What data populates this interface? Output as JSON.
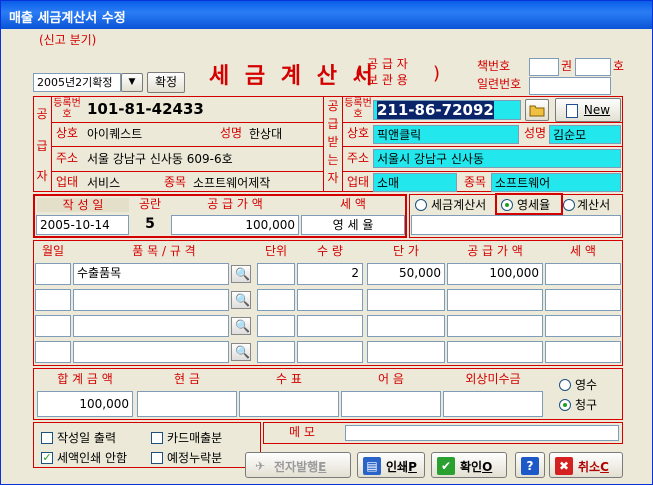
{
  "window": {
    "title": "매출 세금계산서 수정"
  },
  "header": {
    "report_type_label": "(신고 분기)",
    "period_value": "2005년2기확정",
    "confirm_button": "확정",
    "title": "세 금 계 산 서",
    "title_paren": "(",
    "title_paren_close": ")",
    "sub_line1": "공 급 자",
    "sub_line2": "보 관 용",
    "book_label": "책번호",
    "book_unit1": "권",
    "book_unit2": "호",
    "serial_label": "일련번호"
  },
  "supplier": {
    "side_label": [
      "공",
      "급",
      "자"
    ],
    "reg_label": "등록번호",
    "reg_number": "101-81-42433",
    "name_label": "상호",
    "name_value": "아이퀘스트",
    "owner_label": "성명",
    "owner_value": "한상대",
    "addr_label": "주소",
    "addr_value": "서울 강남구 신사동 609-6호",
    "biz_label": "업태",
    "biz_value": "서비스",
    "item_label": "종목",
    "item_value": "소프트웨어제작"
  },
  "buyer": {
    "side_label": [
      "공",
      "급",
      "받",
      "는",
      "자"
    ],
    "reg_label": "등록번호",
    "reg_number": "211-86-72092",
    "new_button": "New",
    "name_label": "상호",
    "name_value": "픽앤클릭",
    "owner_label": "성명",
    "owner_value": "김순모",
    "addr_label": "주소",
    "addr_value": "서울시 강남구 신사동",
    "biz_label": "업태",
    "biz_value": "소매",
    "item_label": "종목",
    "item_value": "소프트웨어"
  },
  "summary": {
    "date_label": "작 성 일",
    "date_value": "2005-10-14",
    "blank_label": "공란",
    "blank_value": "5",
    "supply_label": "공 급 가 액",
    "supply_value": "100,000",
    "tax_label": "세    액",
    "tax_value": "영 세 율",
    "radio_tax_invoice": "세금계산서",
    "radio_zero_rate": "영세율",
    "radio_invoice": "계산서"
  },
  "items": {
    "headers": [
      "월일",
      "품 목 / 규 격",
      "단위",
      "수 량",
      "단 가",
      "공 급 가 액",
      "세    액"
    ],
    "rows": [
      {
        "date": "",
        "item": "수출품목",
        "unit": "",
        "qty": "2",
        "price": "50,000",
        "supply": "100,000",
        "tax": ""
      },
      {
        "date": "",
        "item": "",
        "unit": "",
        "qty": "",
        "price": "",
        "supply": "",
        "tax": ""
      },
      {
        "date": "",
        "item": "",
        "unit": "",
        "qty": "",
        "price": "",
        "supply": "",
        "tax": ""
      },
      {
        "date": "",
        "item": "",
        "unit": "",
        "qty": "",
        "price": "",
        "supply": "",
        "tax": ""
      }
    ]
  },
  "totals": {
    "headers": [
      "합 계 금 액",
      "현    금",
      "수    표",
      "어    음",
      "외상미수금"
    ],
    "values": [
      "100,000",
      "",
      "",
      "",
      ""
    ],
    "radio_receipt": "영수",
    "radio_claim": "청구"
  },
  "options": {
    "print_date": "작성일 출력",
    "card_sales": "카드매출분",
    "no_tax_print": "세액인쇄 안함",
    "scheduled_omit": "예정누락분",
    "memo_label": "메    모",
    "memo_value": ""
  },
  "toolbar": {
    "e_issue": "전자발행",
    "e_issue_key": "E",
    "print": "인쇄",
    "print_key": "P",
    "ok": "확인",
    "ok_key": "O",
    "help": "?",
    "cancel": "취소",
    "cancel_key": "C"
  },
  "colors": {
    "accent_red": "#d40000",
    "field_cyan": "#22e8ee",
    "title_blue": "#0a5ee8"
  }
}
